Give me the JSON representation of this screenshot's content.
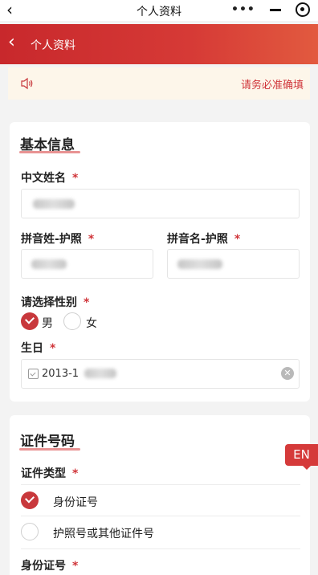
{
  "wx_bar": {
    "title": "个人资料",
    "back_icon": "chevron-left-icon",
    "menu_icon": "more-dots-icon",
    "minimize_icon": "minimize-icon",
    "close_icon": "target-close-icon"
  },
  "header": {
    "title": "个人资料",
    "back_icon": "chevron-left-icon"
  },
  "notice": {
    "icon": "speaker-icon",
    "text": "请务必准确填"
  },
  "basic_info": {
    "title": "基本信息",
    "chinese_name": {
      "label": "中文姓名",
      "required_mark": "*",
      "value_obscured": true
    },
    "pinyin_surname": {
      "label": "拼音姓-护照",
      "required_mark": "*",
      "value_obscured": true
    },
    "pinyin_given_name": {
      "label": "拼音名-护照",
      "required_mark": "*",
      "value_obscured": true
    },
    "gender": {
      "label": "请选择性别",
      "required_mark": "*",
      "options": [
        {
          "label": "男",
          "selected": true
        },
        {
          "label": "女",
          "selected": false
        }
      ]
    },
    "birthday": {
      "label": "生日",
      "required_mark": "*",
      "value": "2013-1",
      "calendar_icon": "calendar-icon",
      "clear_icon": "clear-icon"
    }
  },
  "id_info": {
    "title": "证件号码",
    "doc_type": {
      "label": "证件类型",
      "required_mark": "*",
      "options": [
        {
          "label": "身份证号",
          "selected": true
        },
        {
          "label": "护照号或其他证件号",
          "selected": false
        }
      ]
    },
    "id_number": {
      "label": "身份证号",
      "required_mark": "*"
    }
  },
  "language_toggle": {
    "label": "EN"
  },
  "colors": {
    "brand_red": "#c8282c",
    "notice_bg": "#fdf6ea",
    "title_underline": "#e89393"
  }
}
